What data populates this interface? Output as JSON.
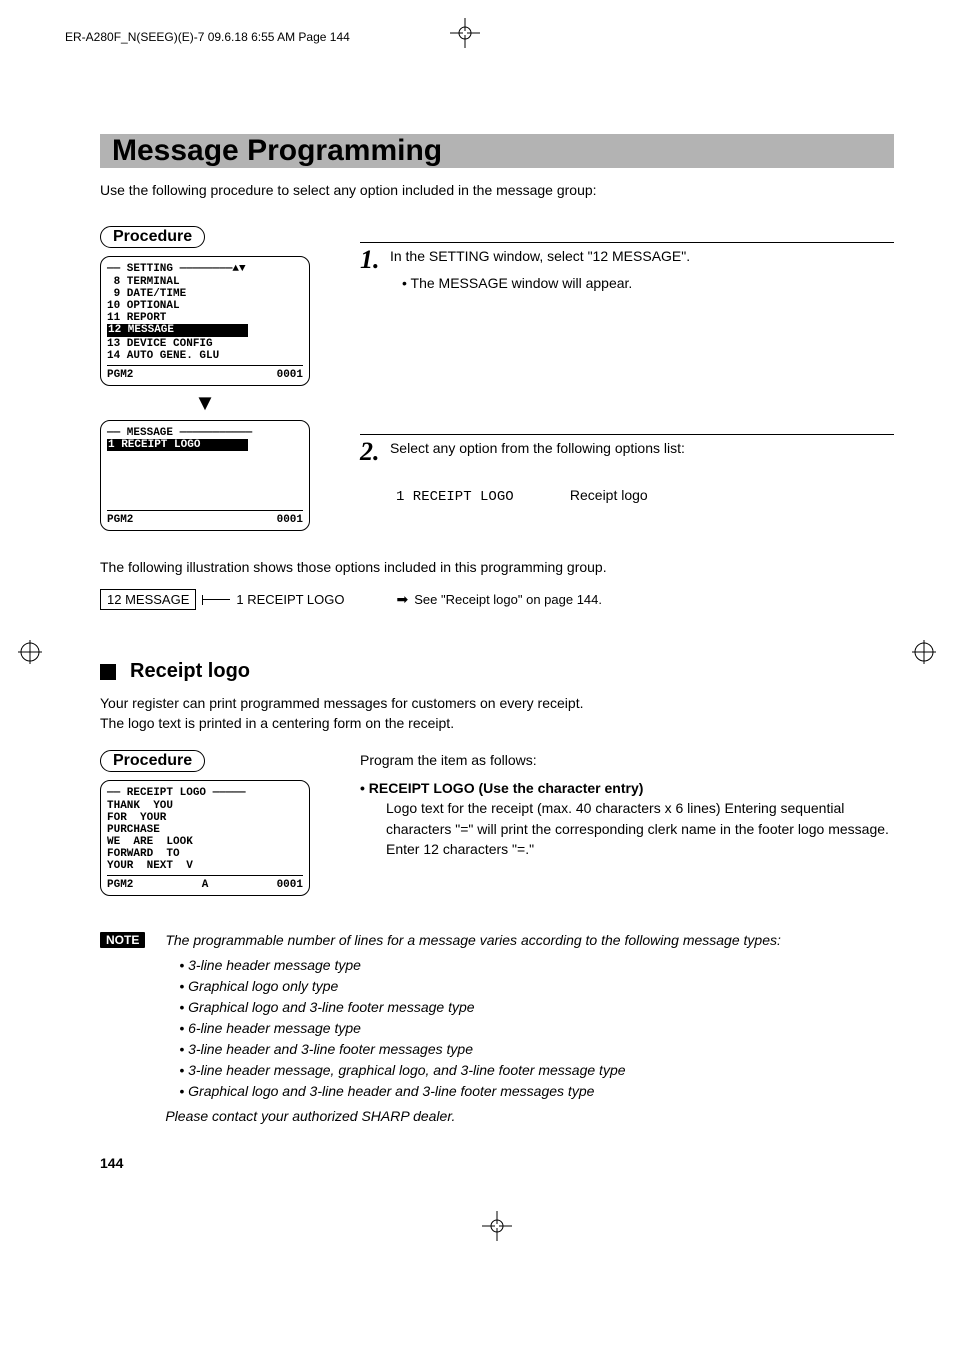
{
  "print_header": "ER-A280F_N(SEEG)(E)-7  09.6.18 6:55 AM  Page 144",
  "title": "Message Programming",
  "intro": "Use the following procedure to select any option included in the message group:",
  "procedure_label": "Procedure",
  "screen1": {
    "header": "—— SETTING ————————▲▼",
    "items_pre": " 8 TERMINAL\n 9 DATE/TIME\n10 OPTIONAL\n11 REPORT",
    "highlight": "12 MESSAGE           ",
    "items_post": "13 DEVICE CONFIG\n14 AUTO GENE. GLU",
    "footer_left": "PGM2",
    "footer_right": "0001"
  },
  "screen2": {
    "header": "—— MESSAGE ———————————",
    "highlight": "1 RECEIPT LOGO       ",
    "footer_left": "PGM2",
    "footer_right": "0001"
  },
  "step1": {
    "num": "1.",
    "text": "In the SETTING window, select \"12 MESSAGE\".",
    "sub": "• The MESSAGE window will appear."
  },
  "step2": {
    "num": "2.",
    "text": "Select any option from the following options list:",
    "option_code": "1 RECEIPT LOGO",
    "option_desc": "Receipt logo"
  },
  "illus_intro": "The following illustration shows those options included in this programming group.",
  "diagram": {
    "box": "12 MESSAGE",
    "branch": "1 RECEIPT LOGO",
    "ref": "See \"Receipt logo\" on page 144."
  },
  "section2": {
    "title": "Receipt logo",
    "body1": "Your register can print programmed messages for customers on every receipt.",
    "body2": "The logo text is printed in a centering form on the receipt.",
    "lead": "Program the item as follows:",
    "bullet_head": "• RECEIPT LOGO (Use the character entry)",
    "detail": "Logo text for the receipt (max. 40 characters x 6 lines) Entering sequential characters \"=\" will print the corresponding clerk name in the footer logo message. Enter 12 characters \"=.\""
  },
  "screen3": {
    "header": "—— RECEIPT LOGO —————",
    "lines": "THANK  YOU\nFOR  YOUR\nPURCHASE\nWE  ARE  LOOK\nFORWARD  TO\nYOUR  NEXT  V",
    "footer_left": "PGM2",
    "footer_mid": "A",
    "footer_right": "0001"
  },
  "note": {
    "label": "NOTE",
    "intro": "The programmable number of lines for a message varies according to the following message types:",
    "items": [
      "3-line header message type",
      "Graphical logo only type",
      "Graphical logo and 3-line footer message type",
      "6-line header message type",
      "3-line header and 3-line footer messages type",
      "3-line header message, graphical logo, and 3-line footer message type",
      "Graphical logo and 3-line header and 3-line footer messages type"
    ],
    "outro": "Please contact your authorized SHARP dealer."
  },
  "page_number": "144"
}
